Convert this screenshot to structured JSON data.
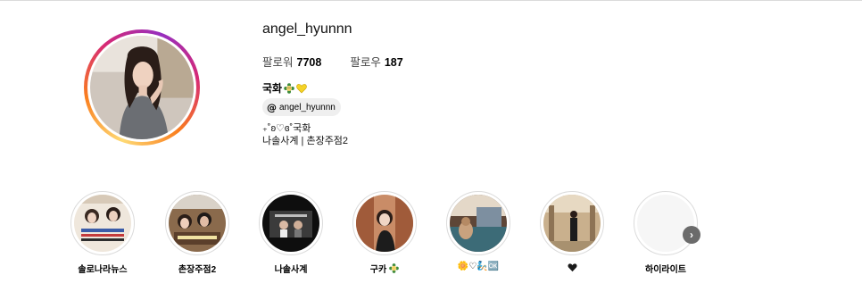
{
  "profile": {
    "username": "angel_hyunnn",
    "followers_label": "팔로워",
    "followers_count": "7708",
    "following_label": "팔로우",
    "following_count": "187",
    "display_name": "국화",
    "name_emojis": [
      "flower-face-emoji",
      "yellow-heart-emoji"
    ],
    "threads_handle": "angel_hyunnn",
    "threads_icon": "threads-icon",
    "bio_line_1": "₊˚ʚ♡ɞ˚국화",
    "bio_line_2": "나솔사계 | 촌장주점2"
  },
  "highlights": [
    {
      "label": "솔로나라뉴스",
      "thumb": "news"
    },
    {
      "label": "촌장주점2",
      "thumb": "pub"
    },
    {
      "label": "나솔사계",
      "thumb": "show"
    },
    {
      "label": "구카",
      "thumb": "portrait",
      "emoji": "flower-face-emoji"
    },
    {
      "label": "",
      "thumb": "room",
      "emoji_string": "🌼♡🧞🆗"
    },
    {
      "label": "",
      "thumb": "hall",
      "emoji": "black-heart-emoji"
    },
    {
      "label": "하이라이트",
      "thumb": "empty"
    }
  ],
  "next_button": {
    "icon": "chevron-right-icon",
    "label": "›"
  },
  "colors": {
    "ring_gradient": [
      "#feda75",
      "#fa7e1e",
      "#d62976",
      "#962fbf"
    ],
    "badge_bg": "#efefef",
    "highlight_border": "#dbdbdb"
  }
}
